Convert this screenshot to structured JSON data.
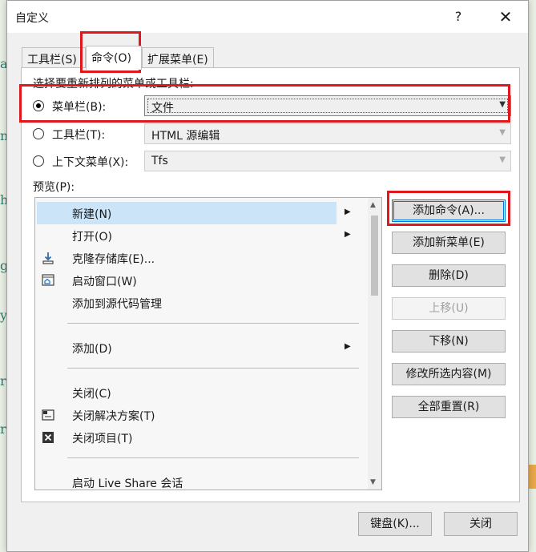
{
  "title": "自定义",
  "help_label": "?",
  "tabs": [
    "工具栏(S)",
    "命令(O)",
    "扩展菜单(E)"
  ],
  "instruction": "选择要重新排列的菜单或工具栏:",
  "options": {
    "menubar": {
      "label": "菜单栏(B):",
      "value": "文件",
      "checked": true
    },
    "toolbar": {
      "label": "工具栏(T):",
      "value": "HTML 源编辑",
      "checked": false
    },
    "context": {
      "label": "上下文菜单(X):",
      "value": "Tfs",
      "checked": false
    }
  },
  "preview_label": "预览(P):",
  "preview_items": [
    {
      "label": "新建(N)",
      "submenu": true,
      "selected": true,
      "icon": ""
    },
    {
      "label": "打开(O)",
      "submenu": true,
      "icon": ""
    },
    {
      "label": "克隆存储库(E)...",
      "icon": "download-icon"
    },
    {
      "label": "启动窗口(W)",
      "icon": "home-window-icon"
    },
    {
      "label": "添加到源代码管理",
      "icon": ""
    },
    {
      "label": "添加(D)",
      "submenu": true,
      "icon": ""
    },
    {
      "label": "关闭(C)",
      "icon": ""
    },
    {
      "label": "关闭解决方案(T)",
      "icon": "close-solution-icon"
    },
    {
      "label": "关闭项目(T)",
      "icon": "close-project-icon"
    },
    {
      "label": "启动 Live Share 会话",
      "icon": ""
    }
  ],
  "buttons": {
    "add_command": "添加命令(A)...",
    "add_menu": "添加新菜单(E)",
    "delete": "删除(D)",
    "move_up": "上移(U)",
    "move_down": "下移(N)",
    "modify": "修改所选内容(M)",
    "reset_all": "全部重置(R)",
    "keyboard": "键盘(K)...",
    "close": "关闭"
  },
  "colors": {
    "highlight": "#e0181d",
    "selection": "#cce4f7",
    "focus": "#0078d7"
  }
}
